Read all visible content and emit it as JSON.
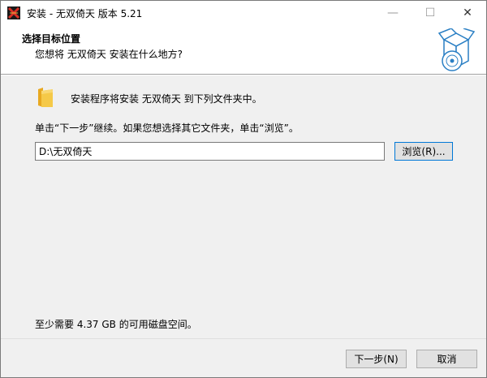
{
  "window": {
    "title": "安装 - 无双倚天 版本 5.21",
    "minimize_glyph": "—",
    "maximize_glyph": "☐",
    "close_glyph": "✕"
  },
  "header": {
    "title": "选择目标位置",
    "subtitle": "您想将 无双倚天 安装在什么地方?"
  },
  "body": {
    "info": "安装程序将安装 无双倚天 到下列文件夹中。",
    "instruction": "单击“下一步”继续。如果您想选择其它文件夹，单击“浏览”。",
    "path_value": "D:\\无双倚天",
    "browse_label": "浏览(R)...",
    "space_required": "至少需要 4.37 GB 的可用磁盘空间。"
  },
  "footer": {
    "next_label": "下一步(N)",
    "cancel_label": "取消"
  },
  "colors": {
    "accent": "#0078d7",
    "folder": "#f5c948",
    "body_bg": "#f0f0f0"
  },
  "icons": [
    "app-icon",
    "minimize-icon",
    "maximize-icon",
    "close-icon",
    "installer-box-icon",
    "folder-icon"
  ]
}
